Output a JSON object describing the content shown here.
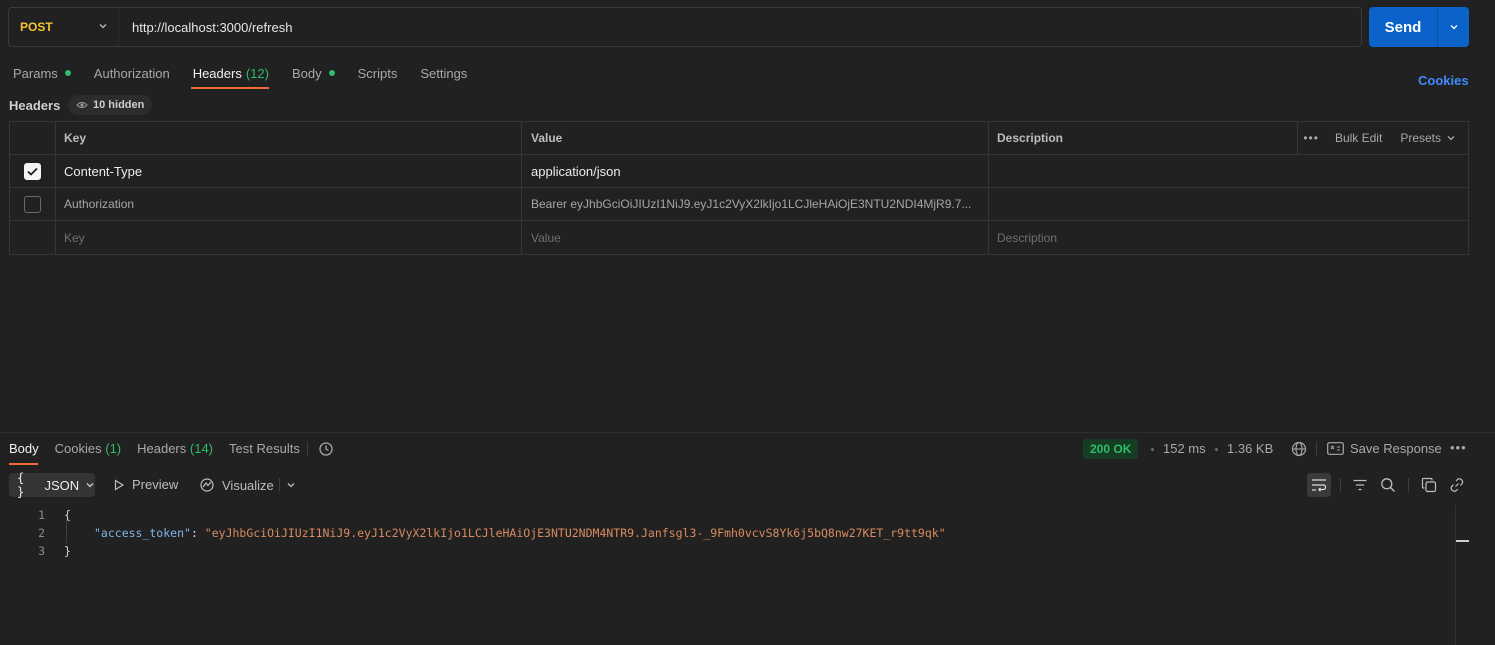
{
  "request": {
    "method": "POST",
    "url": "http://localhost:3000/refresh",
    "send_label": "Send"
  },
  "tabs": {
    "params": "Params",
    "authorization": "Authorization",
    "headers": "Headers",
    "headers_count": "(12)",
    "body": "Body",
    "scripts": "Scripts",
    "settings": "Settings",
    "cookies": "Cookies"
  },
  "headers_section": {
    "title": "Headers",
    "hidden_label": "10 hidden",
    "columns": {
      "key": "Key",
      "value": "Value",
      "description": "Description"
    },
    "actions": {
      "bulk_edit": "Bulk Edit",
      "presets": "Presets"
    },
    "rows": [
      {
        "checked": true,
        "key": "Content-Type",
        "value": "application/json",
        "description": ""
      },
      {
        "checked": false,
        "key": "Authorization",
        "value": "Bearer eyJhbGciOiJIUzI1NiJ9.eyJ1c2VyX2lkIjo1LCJleHAiOjE3NTU2NDI4MjR9.7...",
        "description": ""
      }
    ],
    "placeholder": {
      "key": "Key",
      "value": "Value",
      "description": "Description"
    }
  },
  "response": {
    "tabs": {
      "body": "Body",
      "cookies": "Cookies",
      "cookies_count": "(1)",
      "headers": "Headers",
      "headers_count": "(14)",
      "test_results": "Test Results"
    },
    "status": "200 OK",
    "time": "152 ms",
    "size": "1.36 KB",
    "save_label": "Save Response",
    "format": "JSON",
    "preview": "Preview",
    "visualize": "Visualize",
    "lines": [
      {
        "n": "1",
        "text": "{"
      },
      {
        "n": "2",
        "key": "\"access_token\"",
        "colon": ": ",
        "value": "\"eyJhbGciOiJIUzI1NiJ9.eyJ1c2VyX2lkIjo1LCJleHAiOjE3NTU2NDM4NTR9.Janfsgl3-_9Fmh0vcvS8Yk6j5bQ8nw27KET_r9tt9qk\""
      },
      {
        "n": "3",
        "text": "}"
      }
    ]
  },
  "colors": {
    "background": "#212121",
    "accent": "#f06a3a",
    "send": "#0b63c9",
    "method": "#f4c430",
    "success": "#2ebd6b",
    "link": "#3d8bfd"
  }
}
